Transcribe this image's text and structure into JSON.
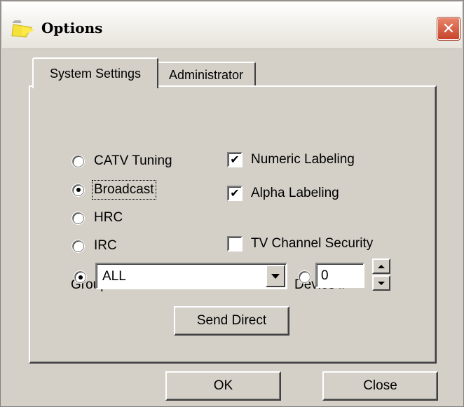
{
  "window": {
    "title": "Options",
    "close_glyph": "✕",
    "title_icon": "folder-arrow-icon"
  },
  "tabs": [
    {
      "label": "System Settings",
      "active": true
    },
    {
      "label": "Administrator",
      "active": false
    }
  ],
  "tuning": {
    "options": [
      {
        "label": "CATV Tuning",
        "selected": false
      },
      {
        "label": "Broadcast",
        "selected": true
      },
      {
        "label": "HRC",
        "selected": false
      },
      {
        "label": "IRC",
        "selected": false
      }
    ]
  },
  "labeling": {
    "numeric": {
      "label": "Numeric Labeling",
      "checked": true
    },
    "alpha": {
      "label": "Alpha Labeling",
      "checked": true
    },
    "security": {
      "label": "TV Channel Security",
      "checked": false
    }
  },
  "group": {
    "label": "Group Name",
    "selected": true,
    "value": "ALL"
  },
  "device": {
    "label": "Device #",
    "selected": false,
    "value": "0"
  },
  "buttons": {
    "send_direct": "Send Direct",
    "ok": "OK",
    "close": "Close"
  },
  "check_glyph": "✔"
}
